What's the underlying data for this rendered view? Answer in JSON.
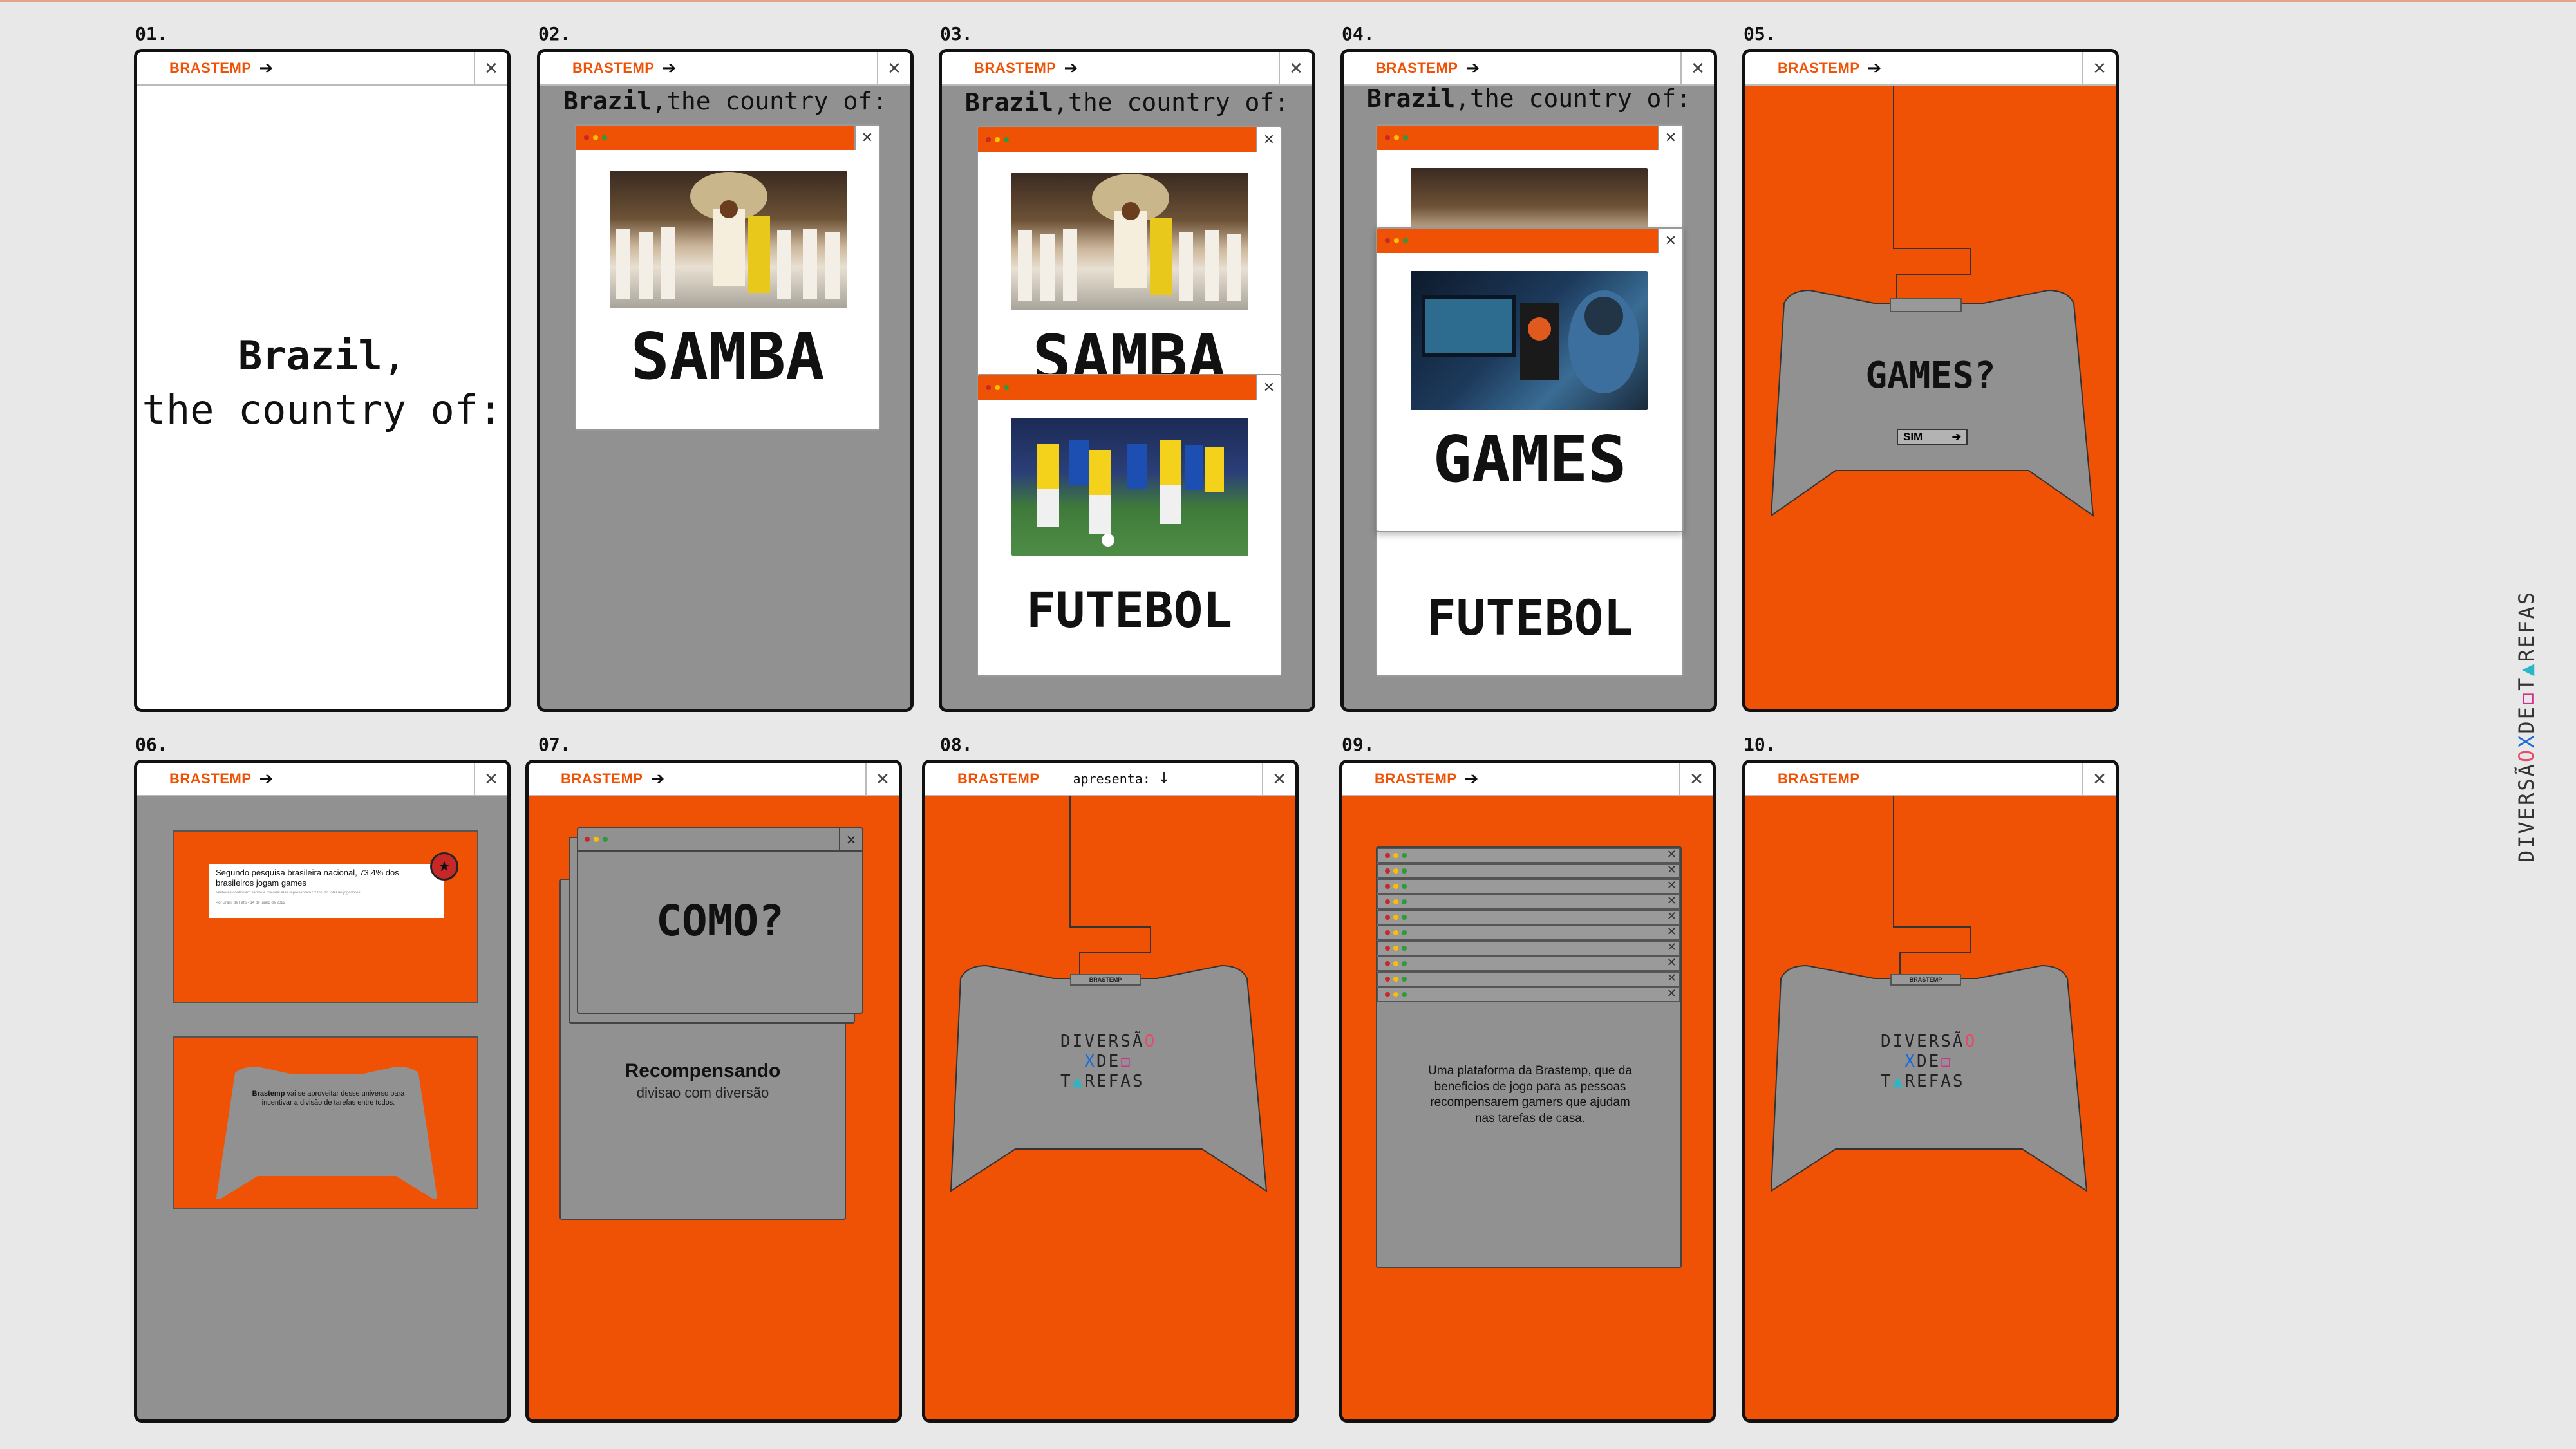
{
  "brand": "BRASTEMP",
  "side_logo": {
    "part1": "DIVERSÃ",
    "o": "O",
    "x": "X",
    "de": "DE",
    "sq": "◻",
    "t": "T",
    "tri": "▲",
    "rest": "REFAS"
  },
  "screens": [
    {
      "num": "01.",
      "heading_bold": "Brazil",
      "heading_rest": ",",
      "heading_line2": "the country of:"
    },
    {
      "num": "02.",
      "heading_bold": "Brazil",
      "heading_rest": ",the country of:",
      "words": [
        "SAMBA"
      ]
    },
    {
      "num": "03.",
      "heading_bold": "Brazil",
      "heading_rest": ",the country of:",
      "words": [
        "SAMBA",
        "FUTEBOL"
      ]
    },
    {
      "num": "04.",
      "heading_bold": "Brazil",
      "heading_rest": ",the country of:",
      "words": [
        "GAMES",
        "FUTEBOL"
      ]
    },
    {
      "num": "05.",
      "question": "GAMES?",
      "button": "SIM"
    },
    {
      "num": "06.",
      "article_title": "Segundo pesquisa brasileira nacional, 73,4% dos brasileiros jogam games",
      "article_sub": "Mulheres continuam sendo a maioria: elas representam 52,8% do total de jogadores",
      "article_meta": "Por Brasil de Fato • 14 de junho de 2022",
      "controller_text_bold": "Brastemp",
      "controller_text": " vai se aproveitar desse universo para incentivar a divisão de tarefas entre todos."
    },
    {
      "num": "07.",
      "question": "COMO?",
      "title": "Recompensando",
      "subtitle": "divisao com diversão"
    },
    {
      "num": "08.",
      "apresenta": "apresenta:",
      "logo_l1": "DIVERSÃ",
      "logo_o": "O",
      "logo_x": "X",
      "logo_de": "DE",
      "logo_sq": "◻",
      "logo_t": "T",
      "logo_tri": "▲",
      "logo_rest": "REFAS",
      "mini": "BRASTEMP"
    },
    {
      "num": "09.",
      "description": "Uma plataforma da Brastemp, que da beneficios de jogo para as pessoas recompensarem gamers que ajudam nas tarefas de casa."
    },
    {
      "num": "10.",
      "logo_l1": "DIVERSÃ",
      "logo_o": "O",
      "logo_x": "X",
      "logo_de": "DE",
      "logo_sq": "◻",
      "logo_t": "T",
      "logo_tri": "▲",
      "logo_rest": "REFAS",
      "mini": "BRASTEMP"
    }
  ],
  "icons": {
    "arrow": "arrow-right-icon",
    "close": "close-icon",
    "down": "arrow-down-icon"
  },
  "colors": {
    "orange": "#f05205",
    "gray": "#919191",
    "frame": "#111111"
  }
}
